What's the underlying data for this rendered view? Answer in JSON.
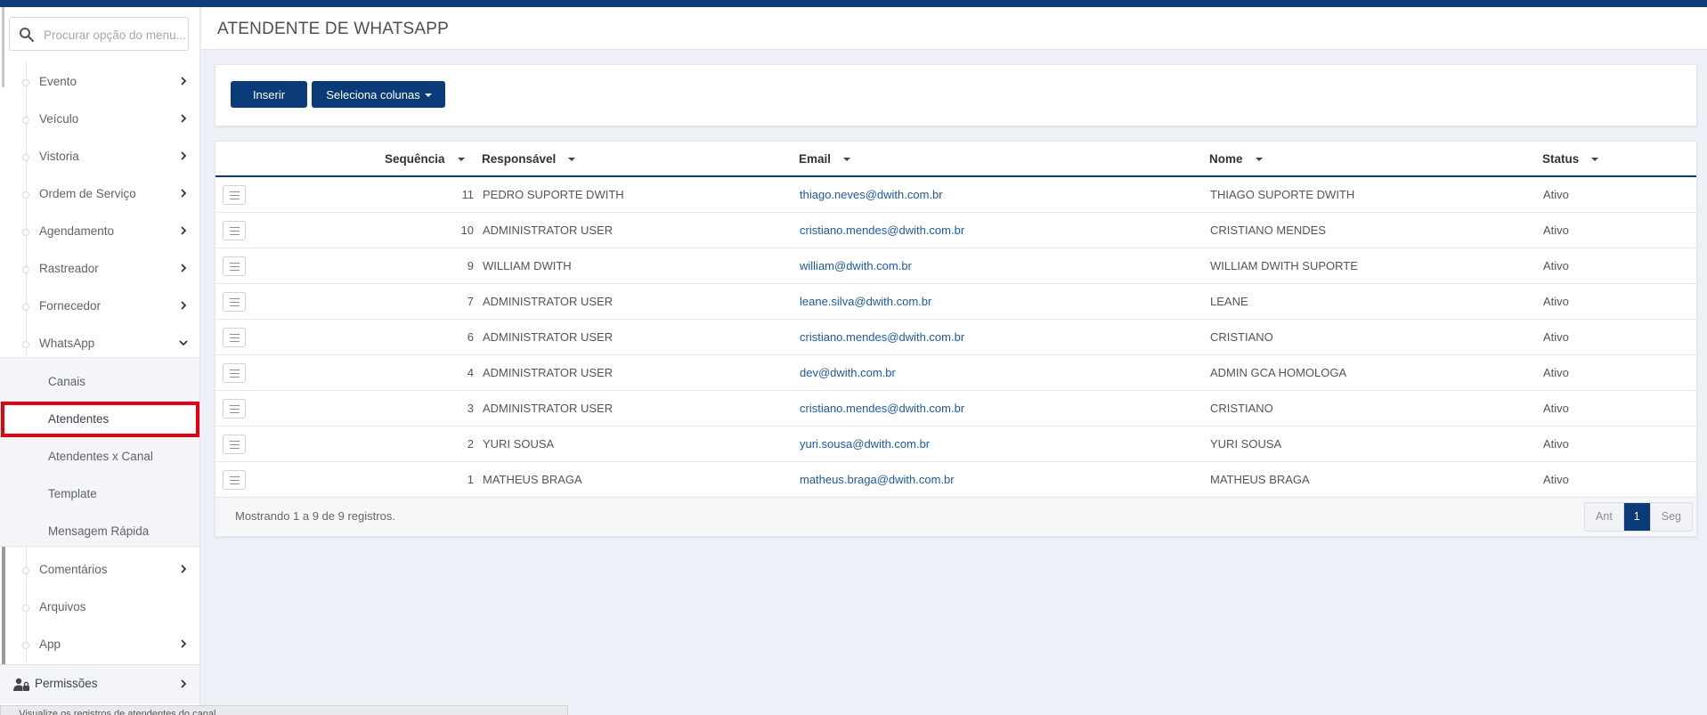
{
  "header": {
    "title": "ATENDENTE DE WHATSAPP"
  },
  "search": {
    "placeholder": "Procurar opção do menu..."
  },
  "sidebar": {
    "items": [
      {
        "label": "Evento"
      },
      {
        "label": "Veículo"
      },
      {
        "label": "Vistoria"
      },
      {
        "label": "Ordem de Serviço"
      },
      {
        "label": "Agendamento"
      },
      {
        "label": "Rastreador"
      },
      {
        "label": "Fornecedor"
      },
      {
        "label": "WhatsApp"
      }
    ],
    "whatsapp_sub": [
      {
        "label": "Canais"
      },
      {
        "label": "Atendentes"
      },
      {
        "label": "Atendentes x Canal"
      },
      {
        "label": "Template"
      },
      {
        "label": "Mensagem Rápida"
      }
    ],
    "after": [
      {
        "label": "Comentários"
      },
      {
        "label": "Arquivos"
      },
      {
        "label": "App"
      }
    ],
    "permissions": "Permissões"
  },
  "toolbar": {
    "insert_label": "Inserir",
    "columns_label": "Seleciona colunas"
  },
  "table": {
    "headers": {
      "seq": "Sequência",
      "resp": "Responsável",
      "email": "Email",
      "nome": "Nome",
      "status": "Status"
    },
    "rows": [
      {
        "seq": "11",
        "resp": "PEDRO SUPORTE DWITH",
        "email": "thiago.neves@dwith.com.br",
        "nome": "THIAGO SUPORTE DWITH",
        "status": "Ativo"
      },
      {
        "seq": "10",
        "resp": "ADMINISTRATOR USER",
        "email": "cristiano.mendes@dwith.com.br",
        "nome": "CRISTIANO MENDES",
        "status": "Ativo"
      },
      {
        "seq": "9",
        "resp": "WILLIAM DWITH",
        "email": "william@dwith.com.br",
        "nome": "WILLIAM DWITH SUPORTE",
        "status": "Ativo"
      },
      {
        "seq": "7",
        "resp": "ADMINISTRATOR USER",
        "email": "leane.silva@dwith.com.br",
        "nome": "LEANE",
        "status": "Ativo"
      },
      {
        "seq": "6",
        "resp": "ADMINISTRATOR USER",
        "email": "cristiano.mendes@dwith.com.br",
        "nome": "CRISTIANO",
        "status": "Ativo"
      },
      {
        "seq": "4",
        "resp": "ADMINISTRATOR USER",
        "email": "dev@dwith.com.br",
        "nome": "ADMIN GCA HOMOLOGA",
        "status": "Ativo"
      },
      {
        "seq": "3",
        "resp": "ADMINISTRATOR USER",
        "email": "cristiano.mendes@dwith.com.br",
        "nome": "CRISTIANO",
        "status": "Ativo"
      },
      {
        "seq": "2",
        "resp": "YURI SOUSA",
        "email": "yuri.sousa@dwith.com.br",
        "nome": "YURI SOUSA",
        "status": "Ativo"
      },
      {
        "seq": "1",
        "resp": "MATHEUS BRAGA",
        "email": "matheus.braga@dwith.com.br",
        "nome": "MATHEUS BRAGA",
        "status": "Ativo"
      }
    ],
    "footer_info": "Mostrando 1 a 9 de 9 registros.",
    "pager": {
      "prev": "Ant",
      "page": "1",
      "next": "Seg"
    }
  },
  "tooltip": "... Visualize os registros de atendentes do canal...",
  "colors": {
    "primary": "#0b3a78",
    "highlight": "#e3000f",
    "link": "#1d5aa3"
  }
}
